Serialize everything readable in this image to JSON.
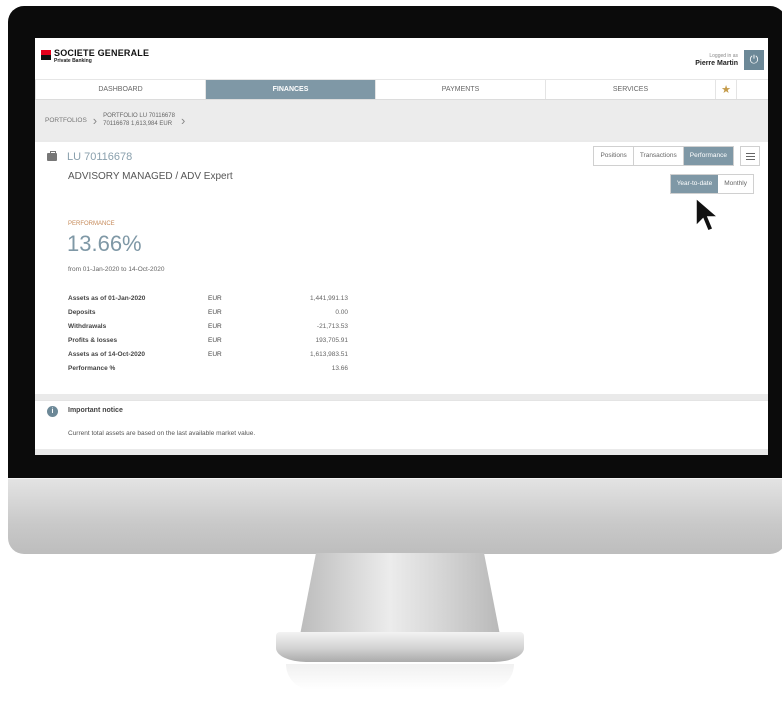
{
  "brand": {
    "name": "SOCIETE GENERALE",
    "subtitle": "Private Banking"
  },
  "login": {
    "label": "Logged in as",
    "user": "Pierre Martin"
  },
  "nav": {
    "tabs": [
      {
        "label": "DASHBOARD",
        "active": false
      },
      {
        "label": "FINANCES",
        "active": true
      },
      {
        "label": "PAYMENTS",
        "active": false
      },
      {
        "label": "SERVICES",
        "active": false
      }
    ]
  },
  "breadcrumb": {
    "root": "PORTFOLIOS",
    "portfolio_line1": "PORTFOLIO LU 70116678",
    "portfolio_line2": "70116678 1,613,984 EUR"
  },
  "account": {
    "id": "LU 70116678",
    "type": "ADVISORY MANAGED / ADV Expert"
  },
  "view_tabs": [
    {
      "label": "Positions",
      "active": false
    },
    {
      "label": "Transactions",
      "active": false
    },
    {
      "label": "Performance",
      "active": true
    }
  ],
  "period_tabs": [
    {
      "label": "Year-to-date",
      "active": true
    },
    {
      "label": "Monthly",
      "active": false
    }
  ],
  "performance": {
    "label": "PERFORMANCE",
    "value": "13.66%",
    "range": "from 01-Jan-2020 to 14-Oct-2020",
    "rows": [
      {
        "label": "Assets as of 01-Jan-2020",
        "currency": "EUR",
        "amount": "1,441,991.13"
      },
      {
        "label": "Deposits",
        "currency": "EUR",
        "amount": "0.00"
      },
      {
        "label": "Withdrawals",
        "currency": "EUR",
        "amount": "-21,713.53"
      },
      {
        "label": "Profits & losses",
        "currency": "EUR",
        "amount": "193,705.91"
      },
      {
        "label": "Assets as of 14-Oct-2020",
        "currency": "EUR",
        "amount": "1,613,983.51"
      },
      {
        "label": "Performance %",
        "currency": "",
        "amount": "13.66"
      }
    ]
  },
  "notice": {
    "title": "Important notice",
    "text": "Current total assets are based on the last available market value."
  },
  "colors": {
    "accent": "#7f98a6",
    "brand_red": "#e3001b",
    "perf_label": "#c68a59"
  }
}
